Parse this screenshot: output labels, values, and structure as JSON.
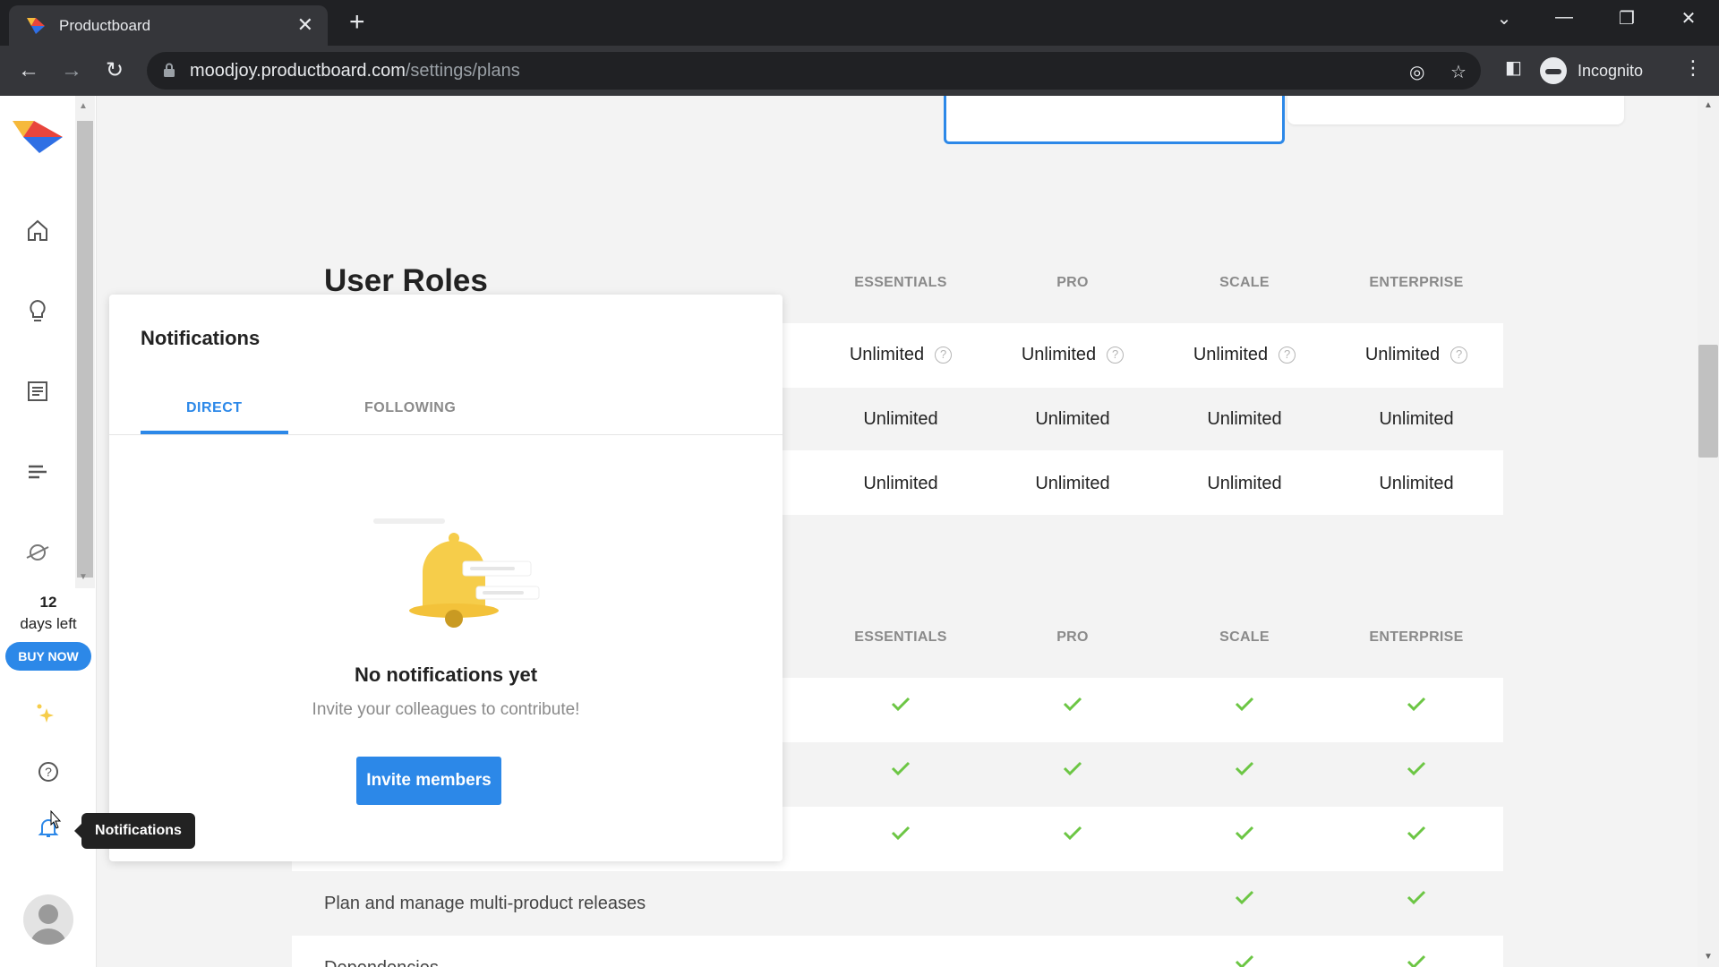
{
  "browser": {
    "tab_title": "Productboard",
    "tab_close": "✕",
    "new_tab": "+",
    "url_host": "moodjoy.productboard.com",
    "url_path": "/settings/plans",
    "incognito_label": "Incognito"
  },
  "rail": {
    "trial_days": "12",
    "trial_label": "days left",
    "buy_now": "BUY NOW"
  },
  "plans": {
    "section_title": "User Roles",
    "columns": [
      "ESSENTIALS",
      "PRO",
      "SCALE",
      "ENTERPRISE"
    ],
    "user_rows": [
      [
        "Unlimited",
        "Unlimited",
        "Unlimited",
        "Unlimited"
      ],
      [
        "Unlimited",
        "Unlimited",
        "Unlimited",
        "Unlimited"
      ],
      [
        "Unlimited",
        "Unlimited",
        "Unlimited",
        "Unlimited"
      ]
    ],
    "help_mark": "?",
    "features": [
      {
        "label": "",
        "checks": [
          true,
          true,
          true,
          true
        ]
      },
      {
        "label": "",
        "checks": [
          true,
          true,
          true,
          true
        ]
      },
      {
        "label": "",
        "checks": [
          true,
          true,
          true,
          true
        ]
      },
      {
        "label": "Plan and manage multi-product releases",
        "checks": [
          false,
          false,
          true,
          true
        ]
      },
      {
        "label": "Dependencies",
        "checks": [
          false,
          false,
          true,
          true
        ]
      }
    ]
  },
  "notifications": {
    "title": "Notifications",
    "tab_direct": "DIRECT",
    "tab_following": "FOLLOWING",
    "empty_title": "No notifications yet",
    "empty_subtitle": "Invite your colleagues to contribute!",
    "invite_button": "Invite members",
    "tooltip": "Notifications"
  },
  "colors": {
    "accent": "#2c88e8",
    "check": "#6cc644",
    "bell": "#f6cd4a"
  }
}
